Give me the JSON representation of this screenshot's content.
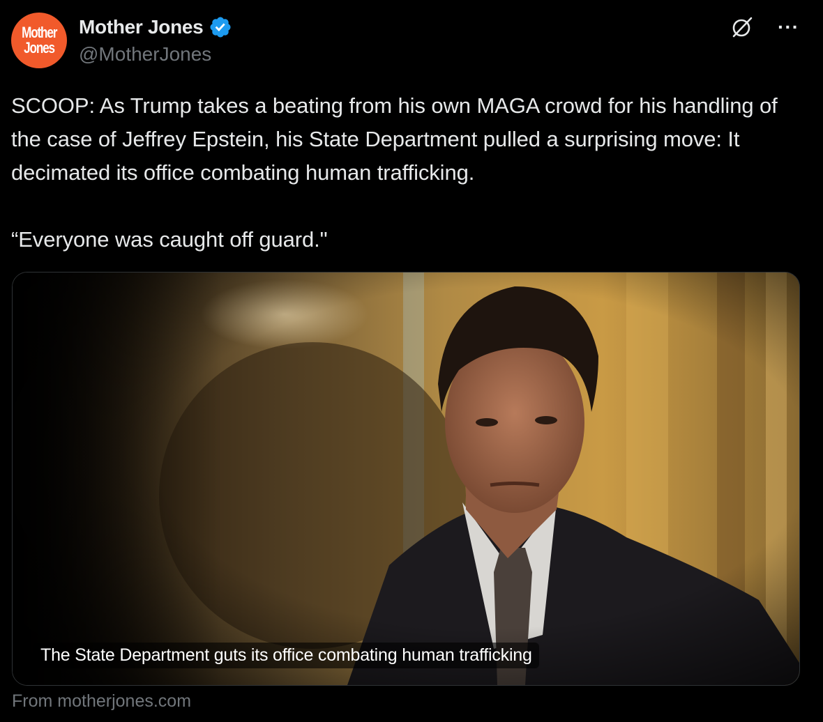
{
  "author": {
    "display_name": "Mother Jones",
    "handle": "@MotherJones",
    "avatar_text": [
      "Mother",
      "Jones"
    ],
    "avatar_color": "#f15a2b",
    "verified": true,
    "verified_color": "#1d9bf0"
  },
  "tweet": {
    "paragraphs": [
      "SCOOP: As Trump takes a beating from his own MAGA crowd for his handling of the case of Jeffrey Epstein, his State Department pulled a surprising move: It decimated its office combating human trafficking.",
      "“Everyone was caught off guard.\""
    ]
  },
  "card": {
    "caption": "The State Department guts its office combating human trafficking",
    "source": "From motherjones.com"
  },
  "icons": {
    "grok": "grok-icon",
    "more": "more-icon",
    "verified": "verified-badge-icon"
  },
  "theme": {
    "background": "#000000",
    "text": "#e7e9ea",
    "secondary_text": "#71767b",
    "border": "#2f3336"
  }
}
